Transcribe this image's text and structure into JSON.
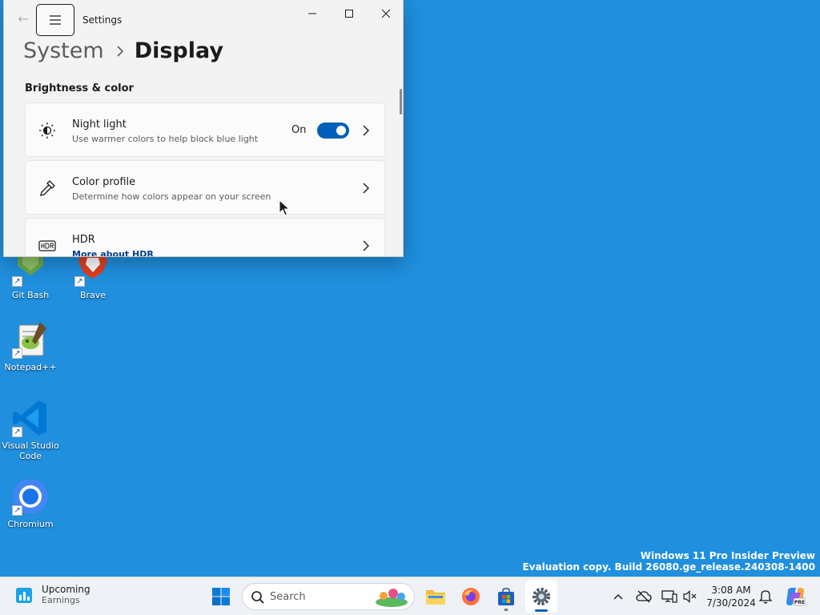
{
  "window": {
    "app_title": "Settings",
    "breadcrumb": {
      "parent": "System",
      "current": "Display"
    },
    "section_title": "Brightness & color",
    "cards": [
      {
        "title": "Night light",
        "description": "Use warmer colors to help block blue light",
        "state": "On",
        "toggle_on": true
      },
      {
        "title": "Color profile",
        "description": "Determine how colors appear on your screen"
      },
      {
        "title": "HDR",
        "link": "More about HDR"
      }
    ]
  },
  "desktop": {
    "icons": [
      {
        "label": "Git Bash"
      },
      {
        "label": "Brave"
      },
      {
        "label": "Notepad++"
      },
      {
        "label": "Visual Studio Code"
      },
      {
        "label": "Chromium"
      }
    ],
    "watermark": {
      "line1": "Windows 11 Pro Insider Preview",
      "line2": "Evaluation copy. Build 26080.ge_release.240308-1400"
    }
  },
  "taskbar": {
    "widget": {
      "title": "Upcoming",
      "subtitle": "Earnings"
    },
    "search_placeholder": "Search",
    "clock": {
      "time": "3:08 AM",
      "date": "7/30/2024"
    }
  },
  "colors": {
    "desktop_bg": "#1f8fde",
    "accent": "#005fb8",
    "window_bg": "#f3f3f3"
  }
}
